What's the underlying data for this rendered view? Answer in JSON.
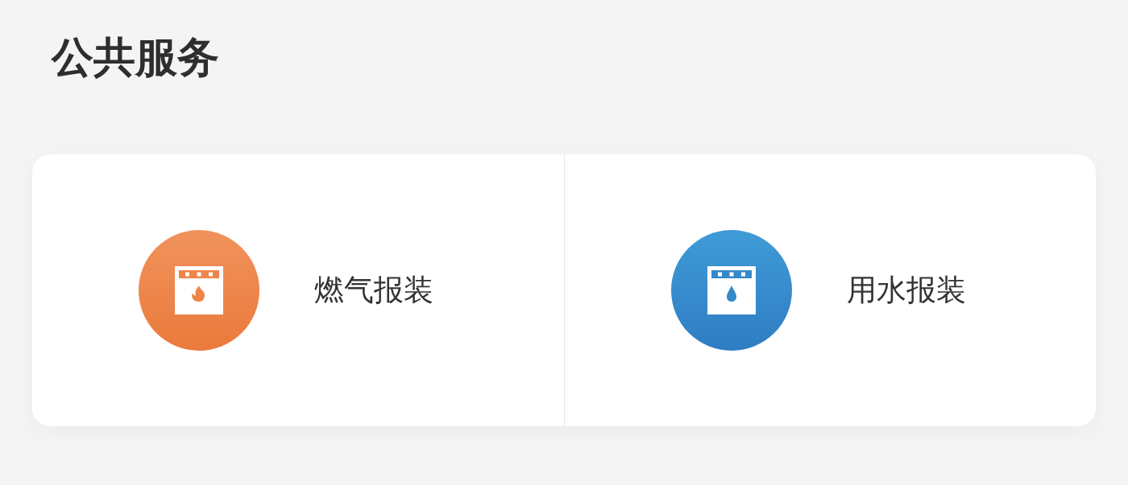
{
  "section": {
    "title": "公共服务"
  },
  "services": [
    {
      "label": "燃气报装",
      "kind": "gas"
    },
    {
      "label": "用水报装",
      "kind": "water"
    }
  ]
}
